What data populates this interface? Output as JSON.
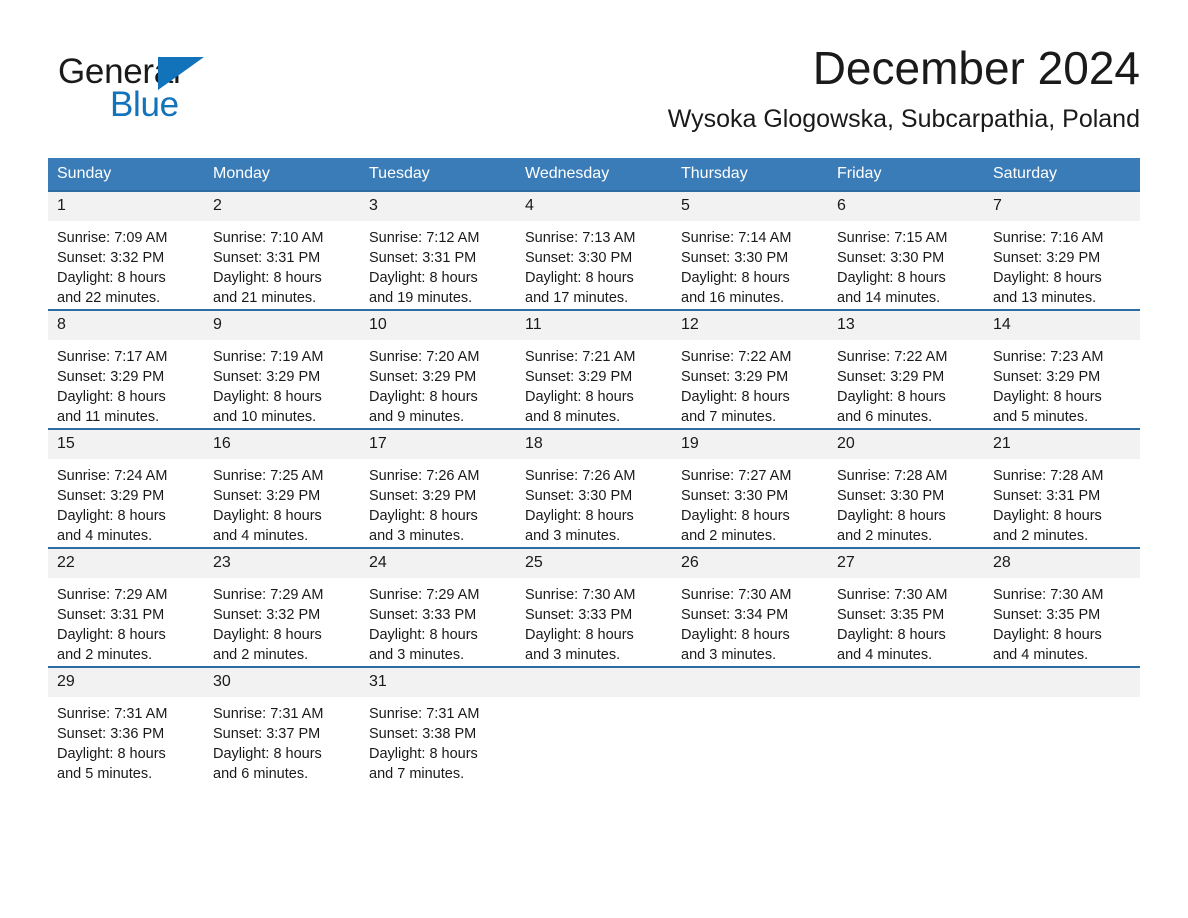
{
  "brand": {
    "word1": "General",
    "word2": "Blue",
    "triangle_color": "#1273ba",
    "icon": "triangle-logo-icon"
  },
  "header": {
    "title": "December 2024",
    "subtitle": "Wysoka Glogowska, Subcarpathia, Poland"
  },
  "theme": {
    "header_bg": "#3a7cb8",
    "row_divider": "#2e6da4",
    "daynum_bg": "#f2f2f2",
    "accent_blue": "#1273ba"
  },
  "columns": [
    "Sunday",
    "Monday",
    "Tuesday",
    "Wednesday",
    "Thursday",
    "Friday",
    "Saturday"
  ],
  "weeks": [
    [
      {
        "day": "1",
        "sunrise": "Sunrise: 7:09 AM",
        "sunset": "Sunset: 3:32 PM",
        "daylight1": "Daylight: 8 hours",
        "daylight2": "and 22 minutes."
      },
      {
        "day": "2",
        "sunrise": "Sunrise: 7:10 AM",
        "sunset": "Sunset: 3:31 PM",
        "daylight1": "Daylight: 8 hours",
        "daylight2": "and 21 minutes."
      },
      {
        "day": "3",
        "sunrise": "Sunrise: 7:12 AM",
        "sunset": "Sunset: 3:31 PM",
        "daylight1": "Daylight: 8 hours",
        "daylight2": "and 19 minutes."
      },
      {
        "day": "4",
        "sunrise": "Sunrise: 7:13 AM",
        "sunset": "Sunset: 3:30 PM",
        "daylight1": "Daylight: 8 hours",
        "daylight2": "and 17 minutes."
      },
      {
        "day": "5",
        "sunrise": "Sunrise: 7:14 AM",
        "sunset": "Sunset: 3:30 PM",
        "daylight1": "Daylight: 8 hours",
        "daylight2": "and 16 minutes."
      },
      {
        "day": "6",
        "sunrise": "Sunrise: 7:15 AM",
        "sunset": "Sunset: 3:30 PM",
        "daylight1": "Daylight: 8 hours",
        "daylight2": "and 14 minutes."
      },
      {
        "day": "7",
        "sunrise": "Sunrise: 7:16 AM",
        "sunset": "Sunset: 3:29 PM",
        "daylight1": "Daylight: 8 hours",
        "daylight2": "and 13 minutes."
      }
    ],
    [
      {
        "day": "8",
        "sunrise": "Sunrise: 7:17 AM",
        "sunset": "Sunset: 3:29 PM",
        "daylight1": "Daylight: 8 hours",
        "daylight2": "and 11 minutes."
      },
      {
        "day": "9",
        "sunrise": "Sunrise: 7:19 AM",
        "sunset": "Sunset: 3:29 PM",
        "daylight1": "Daylight: 8 hours",
        "daylight2": "and 10 minutes."
      },
      {
        "day": "10",
        "sunrise": "Sunrise: 7:20 AM",
        "sunset": "Sunset: 3:29 PM",
        "daylight1": "Daylight: 8 hours",
        "daylight2": "and 9 minutes."
      },
      {
        "day": "11",
        "sunrise": "Sunrise: 7:21 AM",
        "sunset": "Sunset: 3:29 PM",
        "daylight1": "Daylight: 8 hours",
        "daylight2": "and 8 minutes."
      },
      {
        "day": "12",
        "sunrise": "Sunrise: 7:22 AM",
        "sunset": "Sunset: 3:29 PM",
        "daylight1": "Daylight: 8 hours",
        "daylight2": "and 7 minutes."
      },
      {
        "day": "13",
        "sunrise": "Sunrise: 7:22 AM",
        "sunset": "Sunset: 3:29 PM",
        "daylight1": "Daylight: 8 hours",
        "daylight2": "and 6 minutes."
      },
      {
        "day": "14",
        "sunrise": "Sunrise: 7:23 AM",
        "sunset": "Sunset: 3:29 PM",
        "daylight1": "Daylight: 8 hours",
        "daylight2": "and 5 minutes."
      }
    ],
    [
      {
        "day": "15",
        "sunrise": "Sunrise: 7:24 AM",
        "sunset": "Sunset: 3:29 PM",
        "daylight1": "Daylight: 8 hours",
        "daylight2": "and 4 minutes."
      },
      {
        "day": "16",
        "sunrise": "Sunrise: 7:25 AM",
        "sunset": "Sunset: 3:29 PM",
        "daylight1": "Daylight: 8 hours",
        "daylight2": "and 4 minutes."
      },
      {
        "day": "17",
        "sunrise": "Sunrise: 7:26 AM",
        "sunset": "Sunset: 3:29 PM",
        "daylight1": "Daylight: 8 hours",
        "daylight2": "and 3 minutes."
      },
      {
        "day": "18",
        "sunrise": "Sunrise: 7:26 AM",
        "sunset": "Sunset: 3:30 PM",
        "daylight1": "Daylight: 8 hours",
        "daylight2": "and 3 minutes."
      },
      {
        "day": "19",
        "sunrise": "Sunrise: 7:27 AM",
        "sunset": "Sunset: 3:30 PM",
        "daylight1": "Daylight: 8 hours",
        "daylight2": "and 2 minutes."
      },
      {
        "day": "20",
        "sunrise": "Sunrise: 7:28 AM",
        "sunset": "Sunset: 3:30 PM",
        "daylight1": "Daylight: 8 hours",
        "daylight2": "and 2 minutes."
      },
      {
        "day": "21",
        "sunrise": "Sunrise: 7:28 AM",
        "sunset": "Sunset: 3:31 PM",
        "daylight1": "Daylight: 8 hours",
        "daylight2": "and 2 minutes."
      }
    ],
    [
      {
        "day": "22",
        "sunrise": "Sunrise: 7:29 AM",
        "sunset": "Sunset: 3:31 PM",
        "daylight1": "Daylight: 8 hours",
        "daylight2": "and 2 minutes."
      },
      {
        "day": "23",
        "sunrise": "Sunrise: 7:29 AM",
        "sunset": "Sunset: 3:32 PM",
        "daylight1": "Daylight: 8 hours",
        "daylight2": "and 2 minutes."
      },
      {
        "day": "24",
        "sunrise": "Sunrise: 7:29 AM",
        "sunset": "Sunset: 3:33 PM",
        "daylight1": "Daylight: 8 hours",
        "daylight2": "and 3 minutes."
      },
      {
        "day": "25",
        "sunrise": "Sunrise: 7:30 AM",
        "sunset": "Sunset: 3:33 PM",
        "daylight1": "Daylight: 8 hours",
        "daylight2": "and 3 minutes."
      },
      {
        "day": "26",
        "sunrise": "Sunrise: 7:30 AM",
        "sunset": "Sunset: 3:34 PM",
        "daylight1": "Daylight: 8 hours",
        "daylight2": "and 3 minutes."
      },
      {
        "day": "27",
        "sunrise": "Sunrise: 7:30 AM",
        "sunset": "Sunset: 3:35 PM",
        "daylight1": "Daylight: 8 hours",
        "daylight2": "and 4 minutes."
      },
      {
        "day": "28",
        "sunrise": "Sunrise: 7:30 AM",
        "sunset": "Sunset: 3:35 PM",
        "daylight1": "Daylight: 8 hours",
        "daylight2": "and 4 minutes."
      }
    ],
    [
      {
        "day": "29",
        "sunrise": "Sunrise: 7:31 AM",
        "sunset": "Sunset: 3:36 PM",
        "daylight1": "Daylight: 8 hours",
        "daylight2": "and 5 minutes."
      },
      {
        "day": "30",
        "sunrise": "Sunrise: 7:31 AM",
        "sunset": "Sunset: 3:37 PM",
        "daylight1": "Daylight: 8 hours",
        "daylight2": "and 6 minutes."
      },
      {
        "day": "31",
        "sunrise": "Sunrise: 7:31 AM",
        "sunset": "Sunset: 3:38 PM",
        "daylight1": "Daylight: 8 hours",
        "daylight2": "and 7 minutes."
      },
      {
        "day": "",
        "sunrise": "",
        "sunset": "",
        "daylight1": "",
        "daylight2": ""
      },
      {
        "day": "",
        "sunrise": "",
        "sunset": "",
        "daylight1": "",
        "daylight2": ""
      },
      {
        "day": "",
        "sunrise": "",
        "sunset": "",
        "daylight1": "",
        "daylight2": ""
      },
      {
        "day": "",
        "sunrise": "",
        "sunset": "",
        "daylight1": "",
        "daylight2": ""
      }
    ]
  ]
}
